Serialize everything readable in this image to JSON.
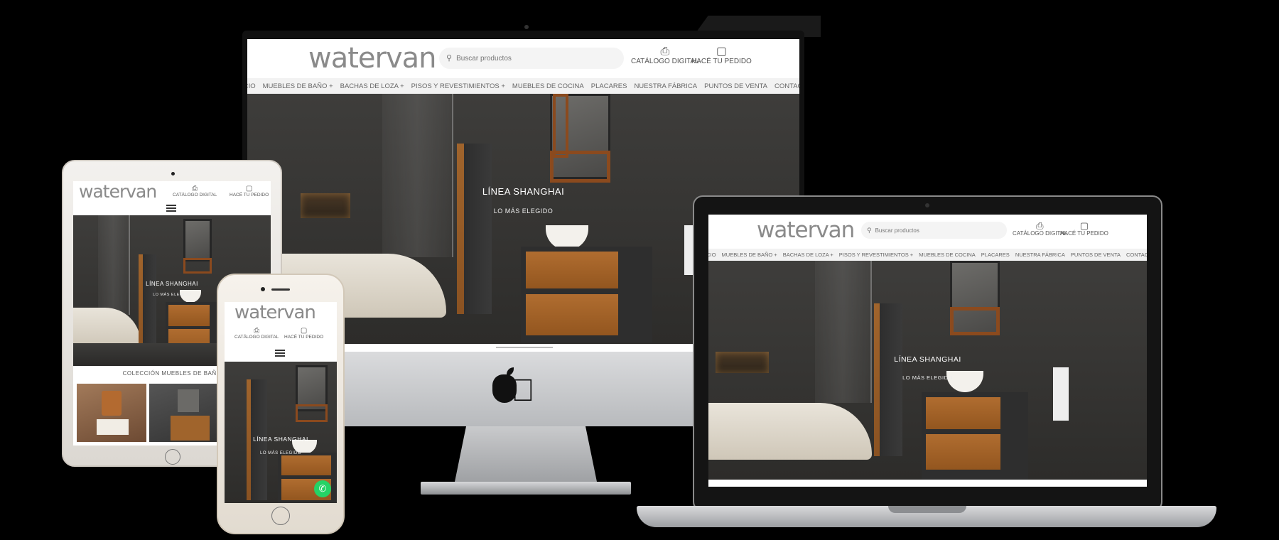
{
  "site": {
    "logo": "watervan",
    "search_placeholder": "Buscar productos",
    "catalog_label": "CATÁLOGO DIGITAL",
    "order_label": "HACÉ TU PEDIDO",
    "nav_items": [
      "INICIO",
      "MUEBLES DE BAÑO +",
      "BACHAS DE LOZA +",
      "PISOS Y REVESTIMIENTOS +",
      "MUEBLES DE COCINA",
      "PLACARES",
      "NUESTRA FÁBRICA",
      "PUNTOS DE VENTA",
      "CONTACTO"
    ],
    "hero_title": "LÍNEA SHANGHAI",
    "hero_subtitle": "LO MÁS ELEGIDO",
    "section_title": "COLECCIÓN MUEBLES DE BAÑO"
  },
  "icons": {
    "search": "search-icon",
    "catalog": "catalog-icon",
    "order": "shopping-bag-icon",
    "menu": "hamburger-menu-icon",
    "whatsapp": "whatsapp-icon",
    "apple": "apple-logo-icon"
  },
  "colors": {
    "background": "#000000",
    "logo": "#8a8a8a",
    "nav_bg": "#f2f2f2",
    "whatsapp": "#25d366",
    "wood": "#a0642c"
  }
}
